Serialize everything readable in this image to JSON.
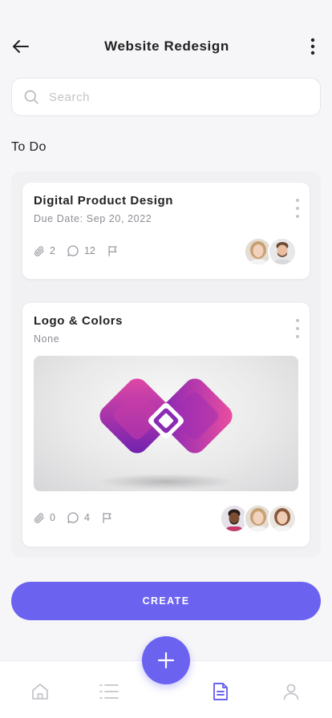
{
  "header": {
    "title": "Website Redesign",
    "back_icon": "arrow-left-icon",
    "menu_icon": "more-vertical-icon"
  },
  "search": {
    "placeholder": "Search",
    "value": ""
  },
  "section": {
    "title": "To Do"
  },
  "cards": [
    {
      "title": "Digital Product Design",
      "subtitle": "Due Date: Sep 20, 2022",
      "attachments": "2",
      "comments": "12",
      "has_image": false,
      "avatars": [
        "avatar-woman-blonde",
        "avatar-man-beard"
      ]
    },
    {
      "title": "Logo & Colors",
      "subtitle": "None",
      "attachments": "0",
      "comments": "4",
      "has_image": true,
      "image": "logo-colors-preview",
      "avatars": [
        "avatar-man-dark",
        "avatar-woman-blonde",
        "avatar-woman-brown"
      ]
    }
  ],
  "create_button": {
    "label": "CREATE"
  },
  "bottom_nav": {
    "items": [
      "home-icon",
      "list-icon",
      "document-icon",
      "profile-icon"
    ],
    "active": "document-icon",
    "fab_icon": "plus-icon"
  },
  "colors": {
    "accent": "#6b63f0",
    "background": "#f6f6f8",
    "card": "#ffffff",
    "muted_text": "#8d8d95"
  }
}
